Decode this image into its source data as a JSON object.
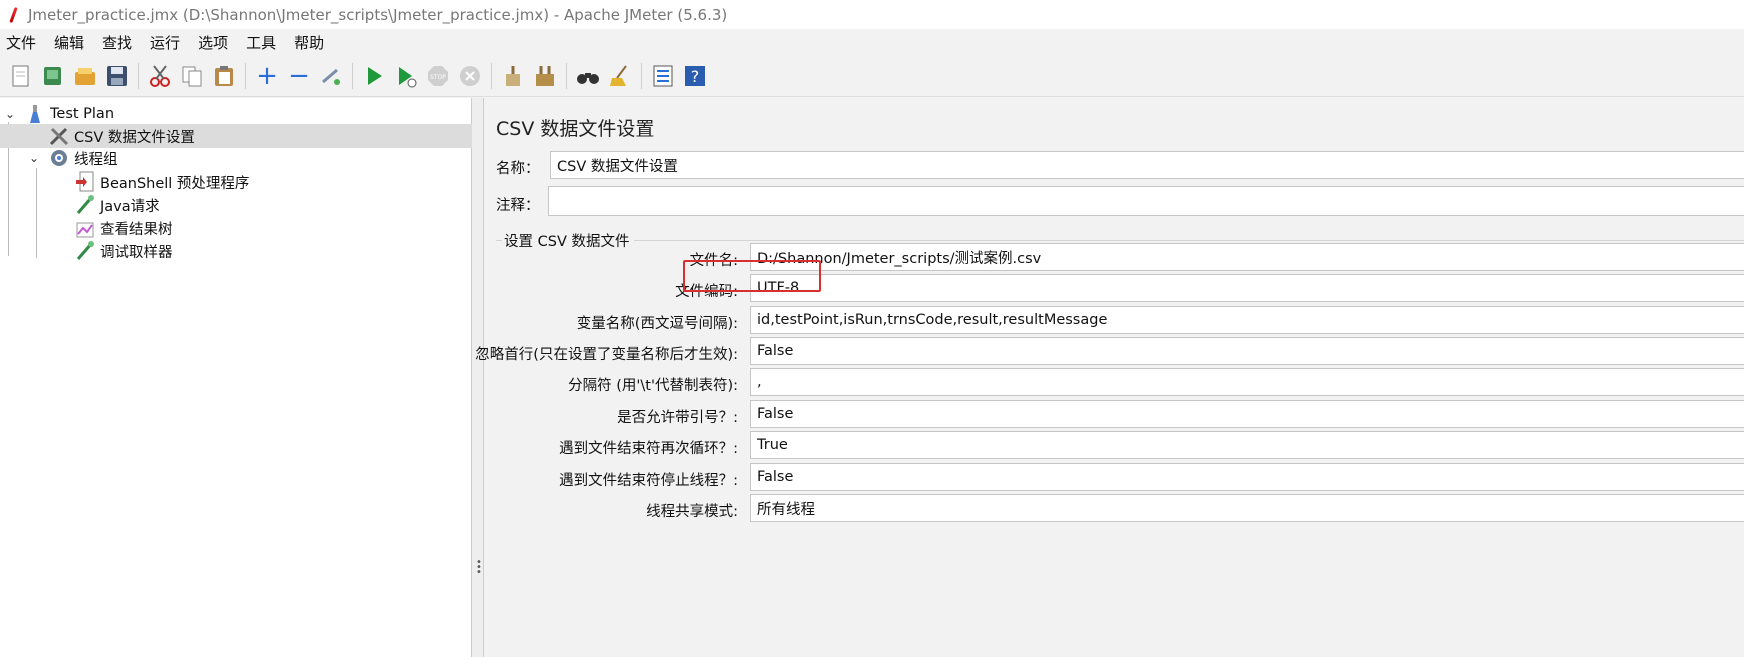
{
  "window": {
    "title": "Jmeter_practice.jmx (D:\\Shannon\\Jmeter_scripts\\Jmeter_practice.jmx) - Apache JMeter (5.6.3)"
  },
  "menu": [
    "文件",
    "编辑",
    "查找",
    "运行",
    "选项",
    "工具",
    "帮助"
  ],
  "toolbar": {
    "icons": [
      "new-icon",
      "templates-icon",
      "open-icon",
      "save-icon",
      "cut-icon",
      "copy-icon",
      "paste-icon",
      "expand-icon",
      "collapse-icon",
      "toggle-icon",
      "start-icon",
      "start-no-pause-icon",
      "stop-icon",
      "shutdown-icon",
      "clear-icon",
      "clear-all-icon",
      "search-icon",
      "reset-search-icon",
      "function-helper-icon",
      "help-icon"
    ]
  },
  "tree": {
    "items": [
      {
        "label": "Test Plan",
        "icon": "flask-icon"
      },
      {
        "label": "CSV 数据文件设置",
        "icon": "tools-icon"
      },
      {
        "label": "线程组",
        "icon": "gear-icon"
      },
      {
        "label": "BeanShell 预处理程序",
        "icon": "script-icon"
      },
      {
        "label": "Java请求",
        "icon": "sampler-icon"
      },
      {
        "label": "查看结果树",
        "icon": "chart-icon"
      },
      {
        "label": "调试取样器",
        "icon": "sampler-icon"
      }
    ]
  },
  "panel": {
    "title": "CSV 数据文件设置",
    "name_label": "名称：",
    "name_value": "CSV 数据文件设置",
    "comment_label": "注释：",
    "comment_value": "",
    "group_title": "设置 CSV 数据文件",
    "fields": [
      {
        "label": "文件名:",
        "value": "D:/Shannon/Jmeter_scripts/测试案例.csv"
      },
      {
        "label": "文件编码:",
        "value": "UTF-8"
      },
      {
        "label": "变量名称(西文逗号间隔):",
        "value": "id,testPoint,isRun,trnsCode,result,resultMessage"
      },
      {
        "label": "忽略首行(只在设置了变量名称后才生效):",
        "value": "False"
      },
      {
        "label": "分隔符 (用'\\t'代替制表符):",
        "value": ","
      },
      {
        "label": "是否允许带引号？:",
        "value": "False"
      },
      {
        "label": "遇到文件结束符再次循环？:",
        "value": "True"
      },
      {
        "label": "遇到文件结束符停止线程？:",
        "value": "False"
      },
      {
        "label": "线程共享模式:",
        "value": "所有线程"
      }
    ]
  },
  "colors": {
    "highlight": "#d9302f",
    "selected_row": "#dcdcdc"
  }
}
